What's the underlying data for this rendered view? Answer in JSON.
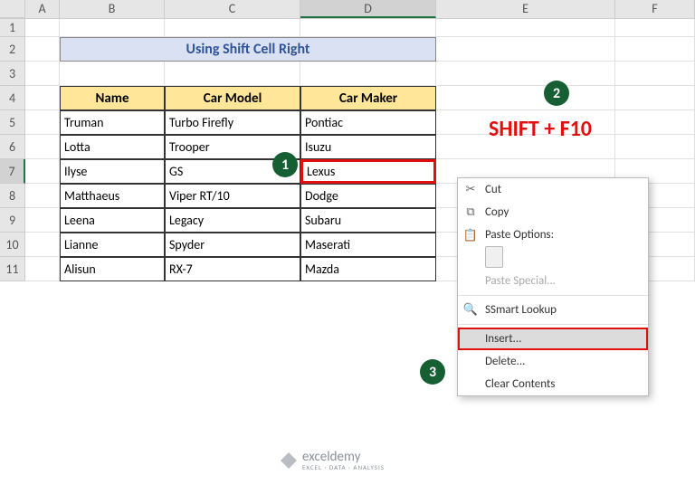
{
  "cols": [
    "A",
    "B",
    "C",
    "D",
    "E",
    "F"
  ],
  "title": "Using Shift Cell Right",
  "headers": {
    "name": "Name",
    "model": "Car Model",
    "maker": "Car Maker"
  },
  "rows": [
    {
      "name": "Truman",
      "model": "Turbo Firefly",
      "maker": "Pontiac"
    },
    {
      "name": "Lotta",
      "model": "Trooper",
      "maker": "Isuzu"
    },
    {
      "name": "Ilyse",
      "model": "GS",
      "maker": "Lexus"
    },
    {
      "name": "Matthaeus",
      "model": "Viper RT/10",
      "maker": "Dodge"
    },
    {
      "name": "Leena",
      "model": "Legacy",
      "maker": "Subaru"
    },
    {
      "name": "Lianne",
      "model": "Spyder",
      "maker": "Maserati"
    },
    {
      "name": "Alisun",
      "model": "RX-7",
      "maker": "Mazda"
    }
  ],
  "shortcut": "SHIFT + F10",
  "steps": {
    "s1": "1",
    "s2": "2",
    "s3": "3"
  },
  "menu": {
    "cut": "Cut",
    "copy": "Copy",
    "pasteOpts": "Paste Options:",
    "pasteSpecial": "Paste Special...",
    "smartLookup": "Smart Lookup",
    "insert": "Insert...",
    "delete": "Delete...",
    "clear": "Clear Contents"
  },
  "brand": {
    "name": "exceldemy",
    "tag": "EXCEL · DATA · ANALYSIS"
  }
}
